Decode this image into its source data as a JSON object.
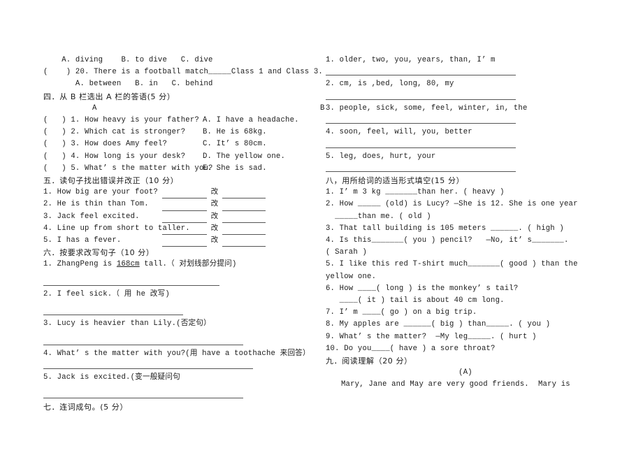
{
  "document": {
    "kind": "english-exam-paper",
    "page_background": "#ffffff",
    "text_color": "#1a1a1a",
    "rule_color": "#555555"
  },
  "left_column": {
    "q19_options": "    A. diving    B. to dive   C. dive",
    "q20_stem": "(    ) 20. There is a football match_____Class 1 and Class 3.",
    "q20_options": "       A. between   B. in   C. behind",
    "section4": {
      "heading": "四．从 B 栏选出 A 栏的答语(5 分）",
      "col_a_header": "A",
      "col_b_header": "B",
      "items": [
        {
          "a": "(   ) 1. How heavy is your father?",
          "b": "A. I have a headache."
        },
        {
          "a": "(   ) 2. Which cat is stronger?",
          "b": "B. He is 68kg."
        },
        {
          "a": "(   ) 3. How does Amy feel?",
          "b": "C. It’ s 80cm."
        },
        {
          "a": "(   ) 4. How long is your desk?",
          "b": "D. The yellow one."
        },
        {
          "a": "(   ) 5. What’ s the matter with you?",
          "b": "E. She is sad."
        }
      ]
    },
    "section5": {
      "heading": "五．读句子找出错误并改正（10 分）",
      "gai_label": "改",
      "items": [
        "1. How big are your foot?",
        "2. He is thin than Tom.",
        "3. Jack feel excited.",
        "4. Line up from short to taller.",
        "5. I has a fever."
      ]
    },
    "section6": {
      "heading": "六．按要求改写句子（10 分）",
      "items": [
        {
          "pre": "1. ZhangPeng is ",
          "underlined": "168cm",
          "post": " tall.（ 对划线部分提问)"
        },
        {
          "pre": "2. I feel sick.（ 用 he 改写)",
          "underlined": "",
          "post": ""
        },
        {
          "pre": "3. Lucy is heavier than Lily.(否定句）",
          "underlined": "",
          "post": ""
        },
        {
          "pre": "4. What’ s the matter with you?(用 have a toothache 来回答）",
          "underlined": "",
          "post": ""
        },
        {
          "pre": "5. Jack is excited.(变一般疑问句",
          "underlined": "",
          "post": ""
        }
      ]
    },
    "section7_heading": "七．连词成句。(5 分）"
  },
  "right_column": {
    "section7_items": [
      "1. older, two, you, years, than, I’ m",
      "2. cm, is ,bed, long, 80, my",
      "3. people, sick, some, feel, winter, in, the",
      "4. soon, feel, will, you, better",
      "5. leg, does, hurt, your"
    ],
    "section8": {
      "heading": "八，用所给词的适当形式填空(15 分）",
      "items": [
        "1. I’ m 3 kg _______than her. ( heavy )",
        "2. How _____ (old) is Lucy? —She is 12. She is one year",
        "  _____than me. ( old )",
        "3. That tall building is 105 meters ______. ( high )",
        "4. Is this_______( you ) pencil?   —No, it’ s_______.",
        "( Sarah )",
        "5. I like this red T-shirt much_______( good ) than the",
        "yellow one.",
        "6. How ____( long ) is the monkey’ s tail?",
        "   ____( it ) tail is about 40 cm long.",
        "7. I’ m ____( go ) on a big trip.",
        "8. My apples are ______( big ) than_____. ( you )",
        "9. What’ s the matter?  —My leg_____. ( hurt )",
        "10. Do you____( have ) a sore throat?"
      ]
    },
    "section9": {
      "heading": "九．阅读理解（20 分）",
      "passage_label": "(A)",
      "passage_first_line": "Mary, Jane and May are very good friends.  Mary is"
    }
  }
}
